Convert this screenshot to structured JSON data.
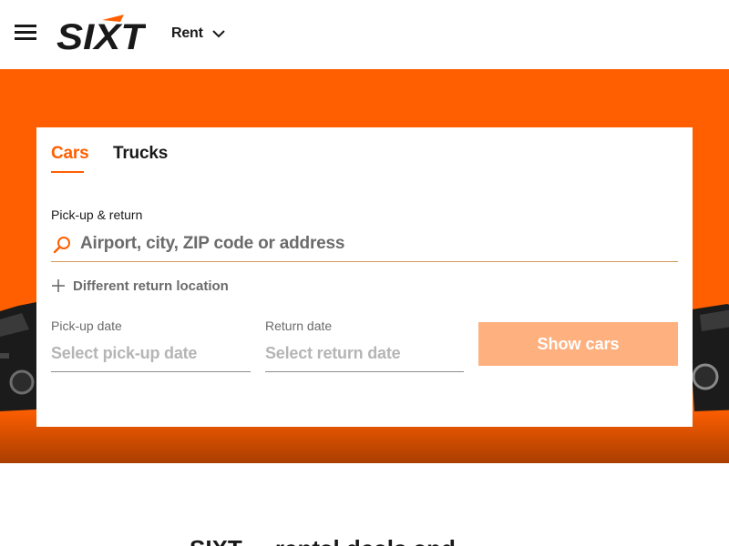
{
  "header": {
    "logo_text": "SIXT",
    "menu_label": "Rent"
  },
  "booking": {
    "tabs": [
      {
        "label": "Cars",
        "active": true
      },
      {
        "label": "Trucks",
        "active": false
      }
    ],
    "pickup_return_label": "Pick-up & return",
    "search_placeholder": "Airport, city, ZIP code or address",
    "different_return_label": "Different return location",
    "pickup_date_label": "Pick-up date",
    "pickup_date_placeholder": "Select pick-up date",
    "return_date_label": "Return date",
    "return_date_placeholder": "Select return date",
    "submit_label": "Show cars"
  },
  "below": {
    "heading_partial": "SIXT ... rental deals and ... "
  },
  "colors": {
    "brand_orange": "#ff5f00",
    "button_disabled": "#ffb07f",
    "text_dark": "#191919",
    "text_muted": "#6b6b6b"
  },
  "icons": [
    "hamburger-menu-icon",
    "sixt-logo",
    "chevron-down-icon",
    "search-icon",
    "plus-icon"
  ]
}
